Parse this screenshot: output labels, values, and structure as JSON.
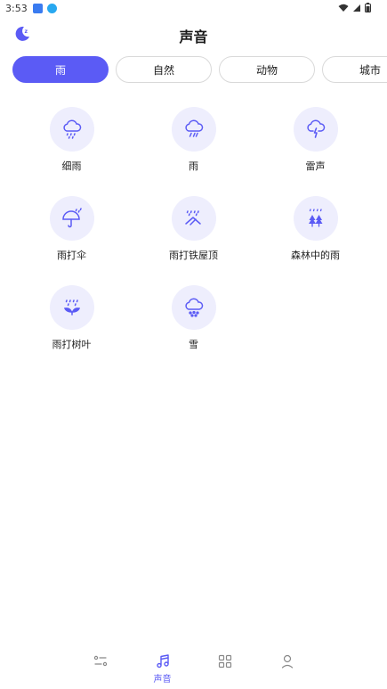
{
  "status_bar": {
    "time": "3:53",
    "icons": [
      "app-notification-icon",
      "download-icon",
      "wifi-icon",
      "signal-icon",
      "battery-icon"
    ]
  },
  "header": {
    "title": "声音",
    "left_icon": "sleep-moon-icon"
  },
  "tabs": [
    {
      "label": "雨",
      "active": true
    },
    {
      "label": "自然",
      "active": false
    },
    {
      "label": "动物",
      "active": false
    },
    {
      "label": "城市",
      "active": false
    }
  ],
  "sounds": [
    {
      "label": "细雨",
      "icon": "drizzle-cloud-icon"
    },
    {
      "label": "雨",
      "icon": "rain-cloud-icon"
    },
    {
      "label": "雷声",
      "icon": "thunder-cloud-icon"
    },
    {
      "label": "雨打伞",
      "icon": "umbrella-rain-icon"
    },
    {
      "label": "雨打铁屋顶",
      "icon": "rain-roof-icon"
    },
    {
      "label": "森林中的雨",
      "icon": "forest-rain-icon"
    },
    {
      "label": "雨打树叶",
      "icon": "rain-leaf-icon"
    },
    {
      "label": "雪",
      "icon": "snow-cloud-icon"
    }
  ],
  "bottom_nav": [
    {
      "label": "",
      "icon": "settings-sliders-icon",
      "active": false
    },
    {
      "label": "声音",
      "icon": "music-note-icon",
      "active": true
    },
    {
      "label": "",
      "icon": "grid-icon",
      "active": false
    },
    {
      "label": "",
      "icon": "profile-icon",
      "active": false
    }
  ],
  "colors": {
    "accent": "#5b5bf5",
    "icon_bg": "#eeeefd",
    "nav_inactive": "#888888"
  }
}
